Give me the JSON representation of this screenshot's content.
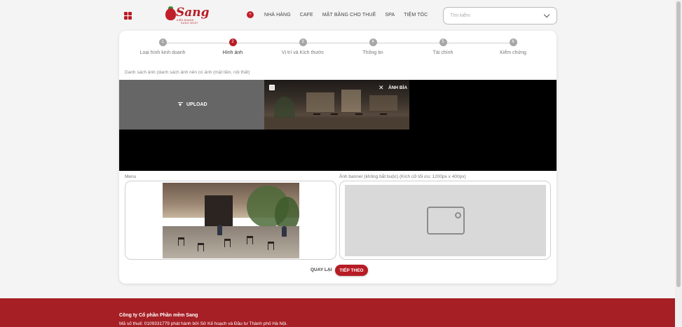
{
  "header": {
    "logo": {
      "wordmark": "Sang",
      "tagline_top": "KIẾN NHANH",
      "tagline_bottom": "SANG NHẤT"
    },
    "nav": {
      "badge": "+",
      "items": [
        "NHÀ HÀNG",
        "CAFE",
        "MẶT BẰNG CHO THUÊ",
        "SPA",
        "TIỆM TÓC"
      ]
    },
    "search": {
      "placeholder": "Tìm kiếm"
    }
  },
  "stepper": {
    "steps": [
      {
        "num": "1",
        "label": "Loại hình kinh doanh"
      },
      {
        "num": "2",
        "label": "Hình ảnh"
      },
      {
        "num": "3",
        "label": "Vị trí và Kích thước"
      },
      {
        "num": "4",
        "label": "Thông tin"
      },
      {
        "num": "5",
        "label": "Tài chính"
      },
      {
        "num": "6",
        "label": "Kiểm chứng"
      }
    ],
    "active_step": 2
  },
  "gallery": {
    "note": "Danh sách ảnh (danh sách ảnh nên có ảnh (mặt tiền, nội thất)",
    "upload_label": "UPLOAD",
    "cover_label": "ẢNH BÌA",
    "remove_glyph": "✕"
  },
  "menu_section": {
    "label": "Menu"
  },
  "banner_section": {
    "label": "Ảnh banner (không bắt buộc) (Kích cỡ tối ưu: 1200px x 400px)"
  },
  "actions": {
    "back_label": "QUAY LẠI",
    "next_label": "TIẾP THEO"
  },
  "footer": {
    "company": "Công ty Cổ phần Phần mềm Sang",
    "registration": "Mã số thuế: 0109331779 phát hành bởi Sở Kế hoạch và Đầu tư Thành phố Hà Nội."
  },
  "colors": {
    "brand": "#b71c25",
    "footer": "#a51f25",
    "step_inactive": "#a6a6a6"
  }
}
